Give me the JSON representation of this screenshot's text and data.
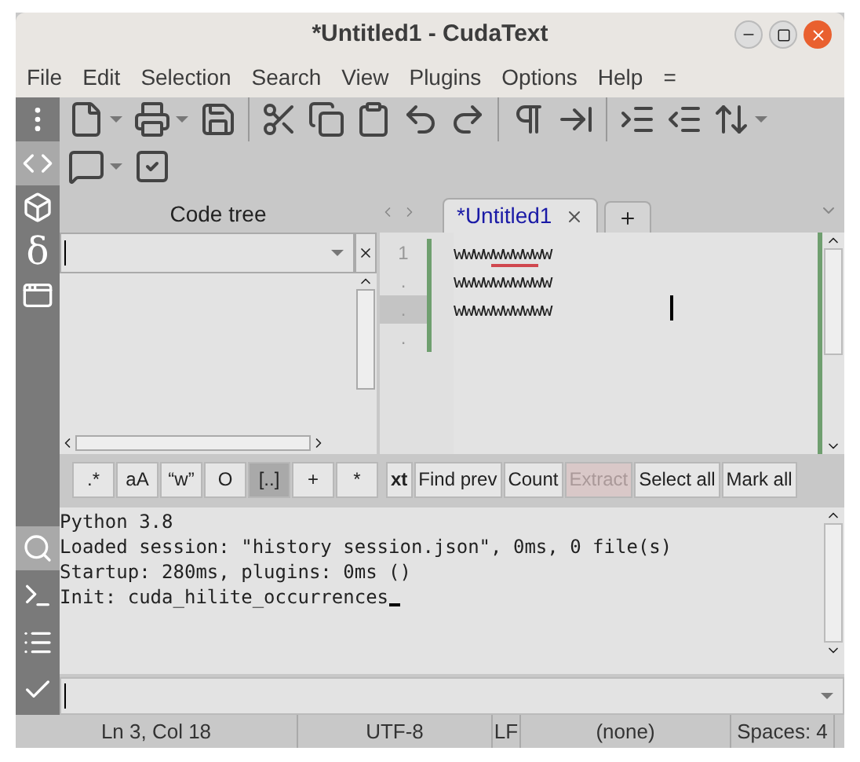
{
  "window": {
    "title": "*Untitled1 - CudaText"
  },
  "menu": [
    "File",
    "Edit",
    "Selection",
    "Search",
    "View",
    "Plugins",
    "Options",
    "Help",
    "="
  ],
  "sidebar_top": [
    {
      "kind": "menu",
      "selected": false
    },
    {
      "kind": "code",
      "selected": true
    },
    {
      "kind": "box",
      "selected": false
    },
    {
      "kind": "glyph",
      "glyph": "δ",
      "selected": false
    },
    {
      "kind": "panel",
      "selected": false
    }
  ],
  "sidebar_bottom": [
    {
      "kind": "search",
      "selected": true
    },
    {
      "kind": "terminal",
      "selected": false
    },
    {
      "kind": "list",
      "selected": false
    },
    {
      "kind": "check",
      "selected": false
    }
  ],
  "code_tree": {
    "title": "Code tree"
  },
  "tabs": [
    {
      "label": "*Untitled1",
      "selected": true
    }
  ],
  "editor": {
    "lines": [
      {
        "number": "1",
        "text": "wwwwwwwwww",
        "current": false
      },
      {
        "number": ".",
        "text": "wwwwwwwwww",
        "current": false
      },
      {
        "number": ".",
        "text": "wwwwwwwwww",
        "current": true
      },
      {
        "number": ".",
        "current": false
      }
    ]
  },
  "find_options": [
    {
      "label": ".*",
      "selected": false
    },
    {
      "label": "aA",
      "selected": false
    },
    {
      "label": "“w”",
      "selected": false
    },
    {
      "label": "O",
      "selected": false
    },
    {
      "label": "[..]",
      "selected": true
    },
    {
      "label": "+",
      "selected": false
    },
    {
      "label": "*",
      "selected": false
    }
  ],
  "find_buttons": [
    {
      "label": "xt",
      "disabled": false
    },
    {
      "label": "Find prev",
      "disabled": false
    },
    {
      "label": "Count",
      "disabled": false
    },
    {
      "label": "Extract",
      "disabled": true
    },
    {
      "label": "Select all",
      "disabled": false
    },
    {
      "label": "Mark all",
      "disabled": false
    }
  ],
  "console": [
    "Python 3.8",
    "Loaded session: \"history session.json\", 0ms, 0 file(s)",
    "Startup: 280ms, plugins: 0ms ()",
    "Init: cuda_hilite_occurrences"
  ],
  "status_bar": [
    "Ln 3, Col 18",
    "UTF-8",
    "LF",
    "(none)",
    "Spaces: 4"
  ]
}
